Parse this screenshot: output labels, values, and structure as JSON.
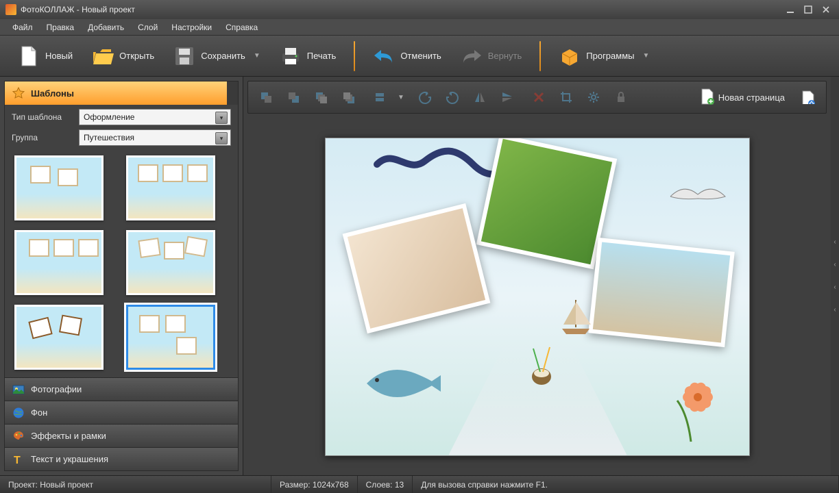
{
  "window": {
    "title": "ФотоКОЛЛАЖ - Новый проект"
  },
  "menu": {
    "file": "Файл",
    "edit": "Правка",
    "add": "Добавить",
    "layer": "Слой",
    "settings": "Настройки",
    "help": "Справка"
  },
  "toolbar": {
    "new": "Новый",
    "open": "Открыть",
    "save": "Сохранить",
    "print": "Печать",
    "undo": "Отменить",
    "redo": "Вернуть",
    "programs": "Программы"
  },
  "sidebar": {
    "templates": "Шаблоны",
    "template_type_label": "Тип шаблона",
    "template_type_value": "Оформление",
    "group_label": "Группа",
    "group_value": "Путешествия",
    "photos": "Фотографии",
    "background": "Фон",
    "effects": "Эффекты и рамки",
    "text": "Текст и украшения"
  },
  "canvas_toolbar": {
    "new_page": "Новая страница"
  },
  "status": {
    "project_label": "Проект:",
    "project_value": "Новый проект",
    "size_label": "Размер:",
    "size_value": "1024x768",
    "layers_label": "Слоев:",
    "layers_value": "13",
    "hint": "Для вызова справки нажмите F1."
  }
}
